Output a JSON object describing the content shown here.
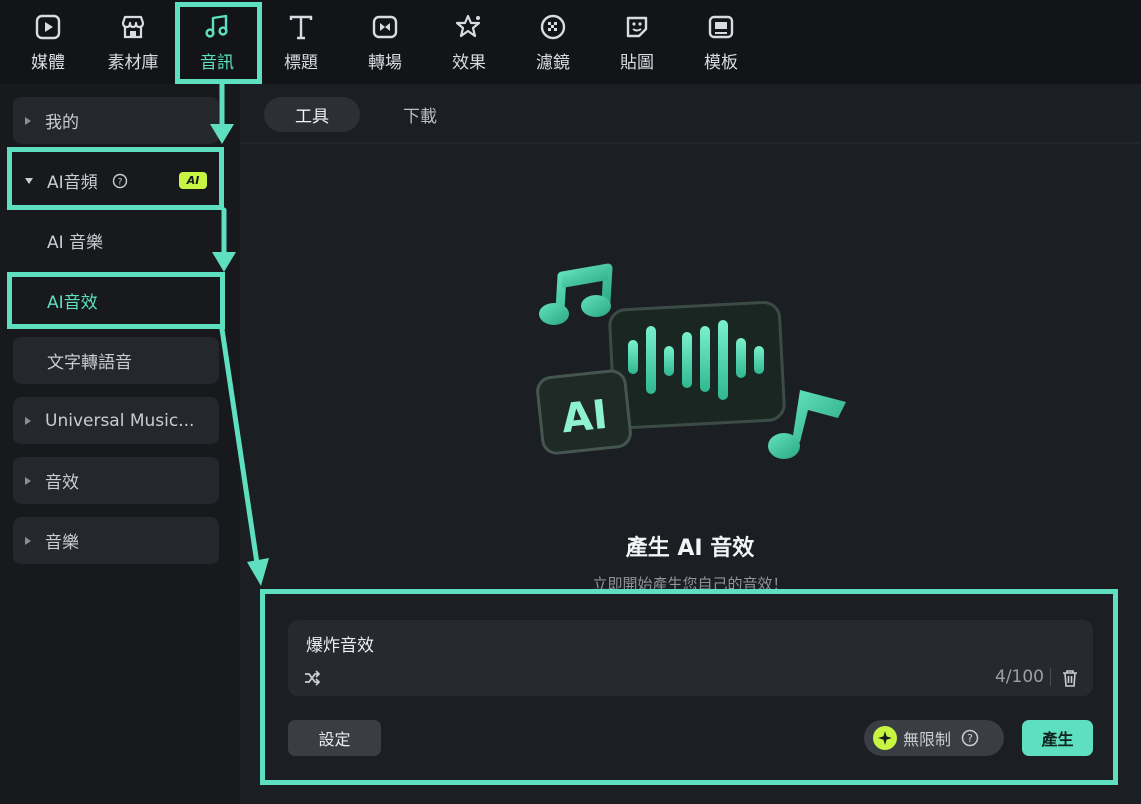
{
  "toolbar": {
    "items": [
      {
        "label": "媒體",
        "icon": "media-icon"
      },
      {
        "label": "素材庫",
        "icon": "store-icon"
      },
      {
        "label": "音訊",
        "icon": "music-note-icon",
        "active": true
      },
      {
        "label": "標題",
        "icon": "text-t-icon"
      },
      {
        "label": "轉場",
        "icon": "transition-icon"
      },
      {
        "label": "效果",
        "icon": "effects-star-icon"
      },
      {
        "label": "濾鏡",
        "icon": "filter-icon"
      },
      {
        "label": "貼圖",
        "icon": "sticker-icon"
      },
      {
        "label": "模板",
        "icon": "template-icon"
      }
    ]
  },
  "sidebar": {
    "items": [
      {
        "label": "我的"
      },
      {
        "label": "AI音頻",
        "badge": "AI",
        "expanded": true
      },
      {
        "label": "AI 音樂"
      },
      {
        "label": "AI音效",
        "selected": true
      },
      {
        "label": "文字轉語音"
      },
      {
        "label": "Universal Music..."
      },
      {
        "label": "音效"
      },
      {
        "label": "音樂"
      }
    ]
  },
  "tabs": [
    {
      "label": "工具",
      "active": true
    },
    {
      "label": "下載"
    }
  ],
  "main": {
    "title": "產生 AI 音效",
    "subtitle": "立即開始產生您自己的音效！",
    "illustration_text": "AI"
  },
  "prompt": {
    "value": "爆炸音效",
    "counter": "4/100"
  },
  "footer": {
    "settings_label": "設定",
    "unlimited_label": "無限制",
    "generate_label": "產生"
  },
  "colors": {
    "accent": "#5ee0c0",
    "ai_badge": "#c8f542",
    "background": "#1b1e23",
    "toolbar": "#121418"
  }
}
